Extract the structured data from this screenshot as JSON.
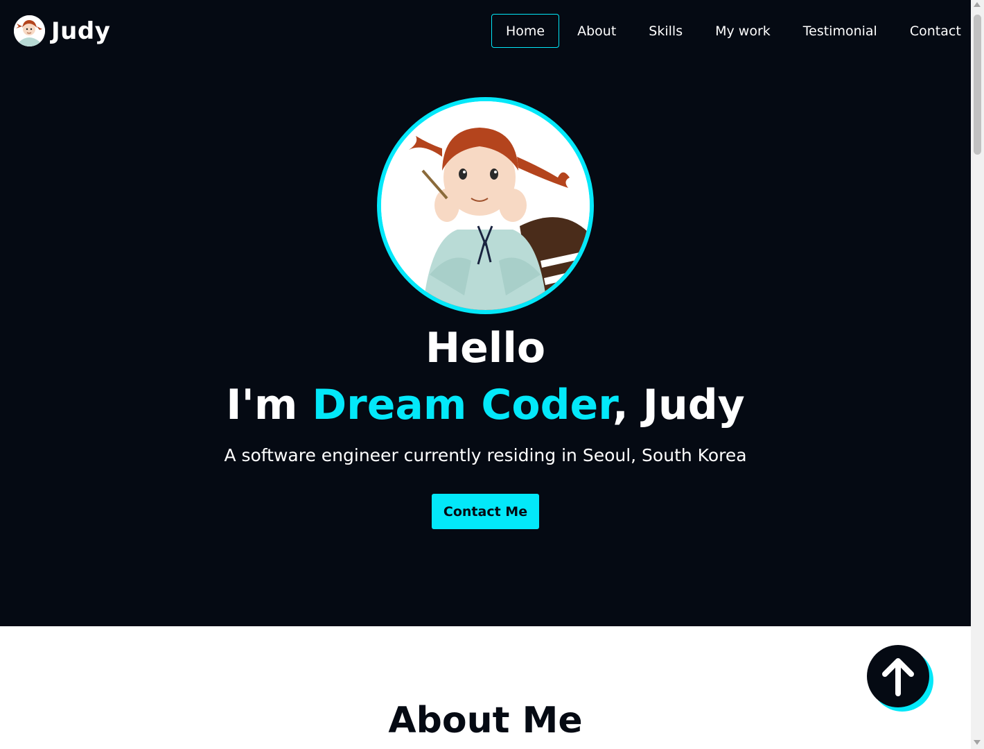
{
  "navbar": {
    "logo_text": "Judy",
    "items": [
      {
        "label": "Home",
        "active": true
      },
      {
        "label": "About",
        "active": false
      },
      {
        "label": "Skills",
        "active": false
      },
      {
        "label": "My work",
        "active": false
      },
      {
        "label": "Testimonial",
        "active": false
      },
      {
        "label": "Contact",
        "active": false
      }
    ]
  },
  "home": {
    "greeting": "Hello",
    "intro_prefix": "I'm ",
    "intro_highlight": "Dream Coder",
    "intro_suffix": ", Judy",
    "description": "A software engineer currently residing in Seoul, South Korea",
    "contact_button": "Contact Me"
  },
  "about": {
    "title": "About Me"
  },
  "icons": {
    "arrow_up": "arrow-up-icon",
    "avatar": "girl-illustration"
  },
  "colors": {
    "background_dark": "#050a13",
    "accent": "#03e8f9",
    "text_light": "#ffffff",
    "background_light": "#ffffff"
  }
}
